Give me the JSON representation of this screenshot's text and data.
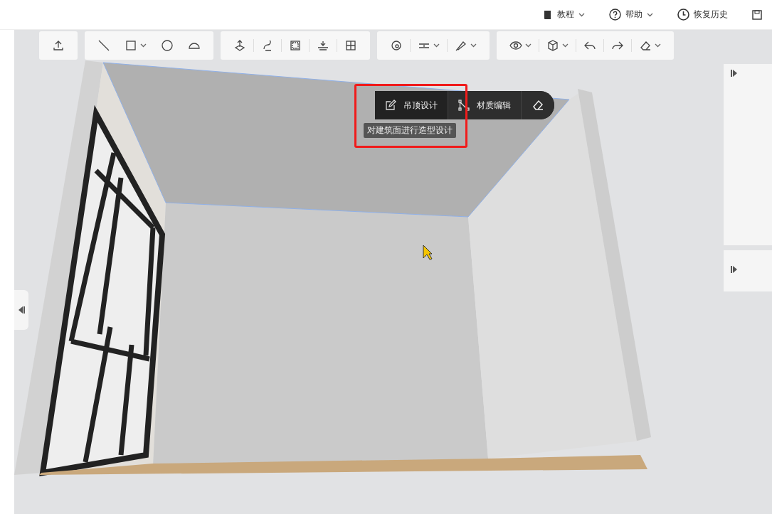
{
  "top_bar": {
    "menus": [
      {
        "label": "教程",
        "dropdown": true
      },
      {
        "label": "帮助",
        "dropdown": true
      },
      {
        "label": "恢复历史",
        "dropdown": false
      }
    ]
  },
  "toolbar": {
    "groups": [
      {
        "tools": [
          {
            "dropdown": false
          }
        ]
      },
      {
        "tools": [
          {
            "dropdown": false
          },
          {
            "dropdown": true
          },
          {
            "dropdown": false
          },
          {
            "dropdown": false
          }
        ]
      },
      {
        "tools": [
          {
            "dropdown": false
          },
          {
            "dropdown": false
          },
          {
            "dropdown": false
          },
          {
            "dropdown": false
          },
          {
            "dropdown": false
          }
        ]
      },
      {
        "tools": [
          {
            "dropdown": false
          },
          {
            "dropdown": true
          },
          {
            "dropdown": true
          }
        ]
      },
      {
        "tools": [
          {
            "dropdown": true
          },
          {
            "dropdown": true
          },
          {
            "dropdown": false
          },
          {
            "dropdown": false
          },
          {
            "dropdown": true
          }
        ]
      }
    ]
  },
  "context_menu": {
    "items": [
      {
        "label": "吊顶设计"
      },
      {
        "label": "材质编辑"
      }
    ],
    "tooltip": "对建筑面进行造型设计",
    "highlighted": true
  }
}
